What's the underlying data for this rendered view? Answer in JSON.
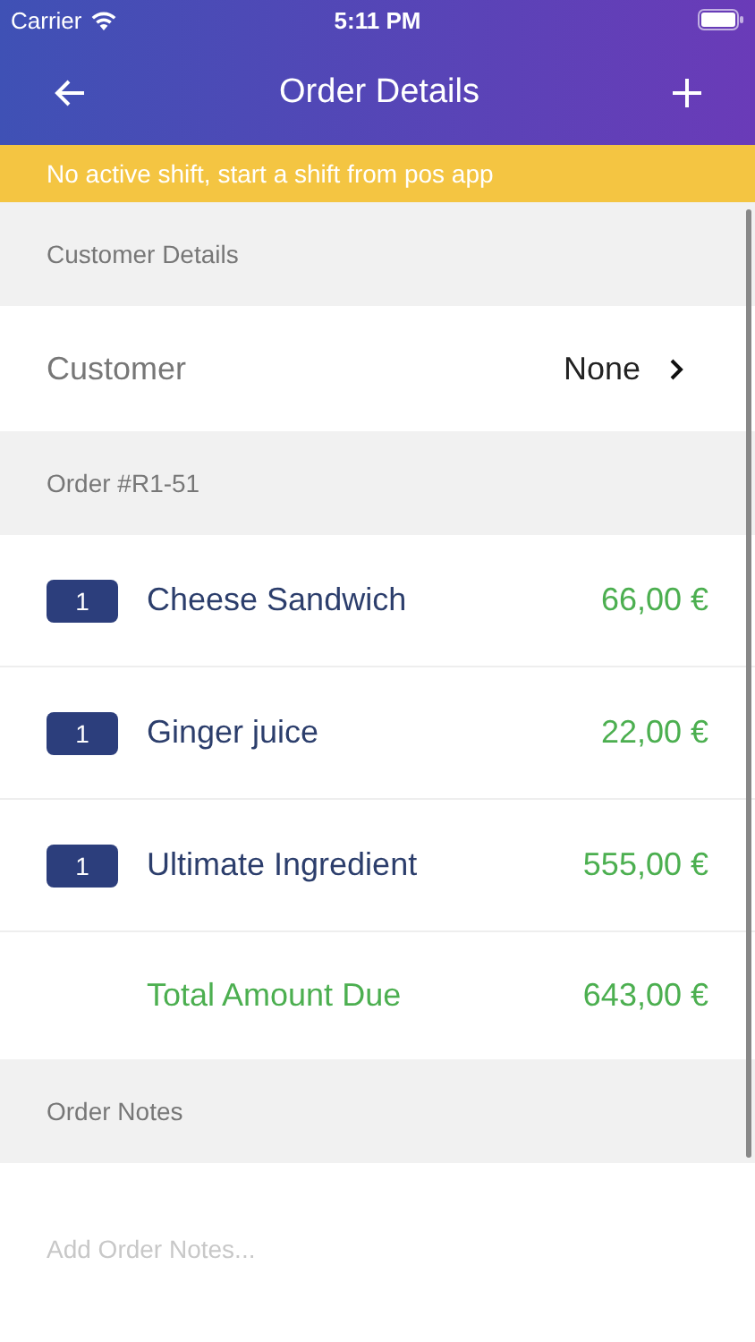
{
  "status_bar": {
    "carrier": "Carrier",
    "time": "5:11 PM"
  },
  "nav": {
    "title": "Order Details"
  },
  "banner": "No active shift, start a shift from pos app",
  "customer_section": {
    "header": "Customer Details",
    "label": "Customer",
    "value": "None"
  },
  "order": {
    "header": "Order #R1-51",
    "items": [
      {
        "qty": "1",
        "name": "Cheese Sandwich",
        "price": "66,00 €"
      },
      {
        "qty": "1",
        "name": "Ginger juice",
        "price": "22,00 €"
      },
      {
        "qty": "1",
        "name": "Ultimate Ingredient",
        "price": "555,00 €"
      }
    ],
    "total_label": "Total Amount Due",
    "total": "643,00 €"
  },
  "notes": {
    "header": "Order Notes",
    "placeholder": "Add Order Notes..."
  }
}
